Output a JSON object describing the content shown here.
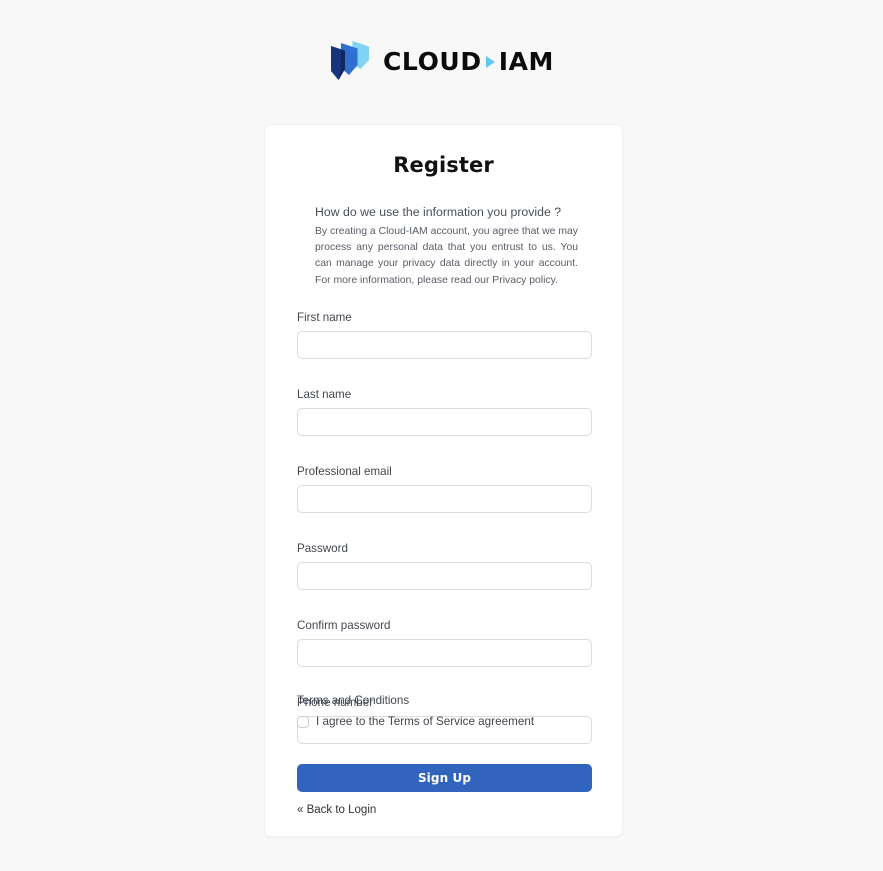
{
  "brand": {
    "name_part_1": "CLOUD",
    "name_part_2": "IAM",
    "logo_icon": "shield-stack-icon",
    "separator_icon": "triangle-right-icon",
    "colors": {
      "shield_dark": "#18347e",
      "shield_mid": "#2f6fd0",
      "shield_light": "#7fd3f5",
      "separator": "#62c6ef",
      "wordmark": "#0c0c0c"
    }
  },
  "card": {
    "title": "Register"
  },
  "privacy": {
    "heading": "How do we use the information you provide ?",
    "body": "By creating a Cloud-IAM account, you agree that we may process any personal data that you entrust to us. You can manage your privacy data directly in your account. For more information, please read our Privacy policy."
  },
  "form": {
    "fields": [
      {
        "name": "first-name",
        "label": "First name",
        "value": "",
        "placeholder": "",
        "type": "text"
      },
      {
        "name": "last-name",
        "label": "Last name",
        "value": "",
        "placeholder": "",
        "type": "text"
      },
      {
        "name": "professional-email",
        "label": "Professional email",
        "value": "",
        "placeholder": "",
        "type": "email"
      },
      {
        "name": "password",
        "label": "Password",
        "value": "",
        "placeholder": "",
        "type": "password"
      },
      {
        "name": "confirm-password",
        "label": "Confirm password",
        "value": "",
        "placeholder": "",
        "type": "password"
      },
      {
        "name": "phone-number",
        "label": "Phone number",
        "value": "",
        "placeholder": "",
        "type": "tel"
      }
    ]
  },
  "terms": {
    "label": "Terms and Conditions",
    "checkbox_text": "I agree to the Terms of Service agreement",
    "checked": false
  },
  "actions": {
    "submit_label": "Sign Up",
    "submit_color": "#3164bd",
    "back_label": "« Back to Login"
  },
  "theme": {
    "page_background": "#f8f8f9",
    "card_background": "#ffffff",
    "input_border": "#dcdcde",
    "label_color": "#43474e"
  }
}
